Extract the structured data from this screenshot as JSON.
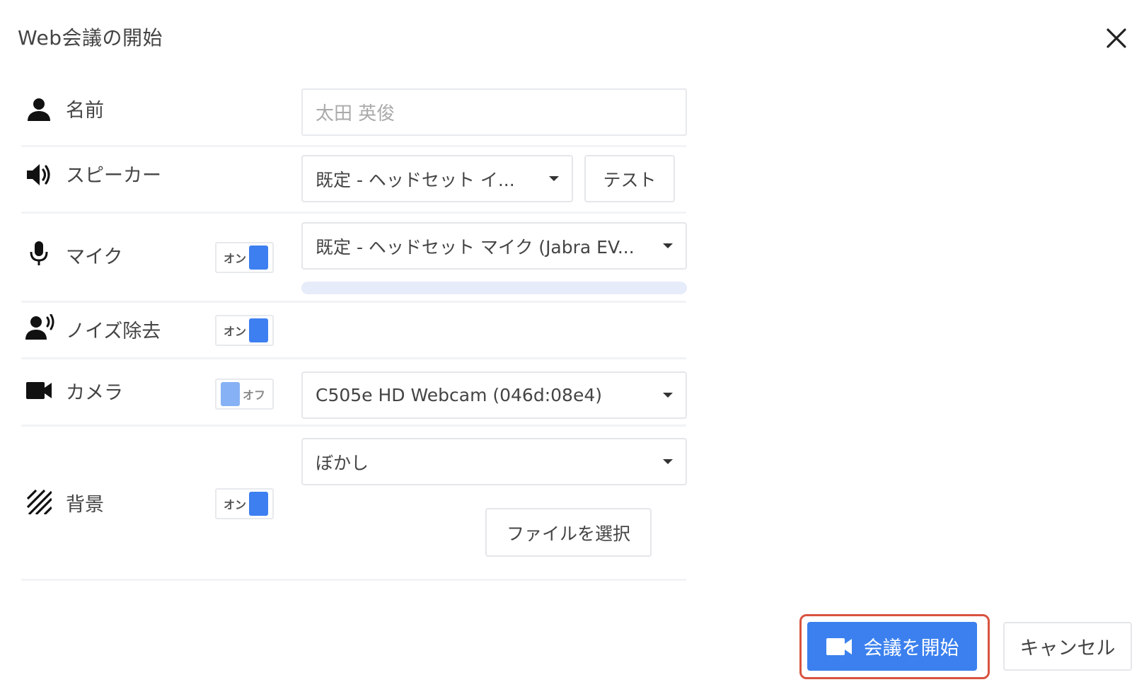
{
  "dialog": {
    "title": "Web会議の開始"
  },
  "name_row": {
    "label": "名前",
    "value": "太田 英俊"
  },
  "speaker_row": {
    "label": "スピーカー",
    "selected": "既定 - ヘッドセット イ...",
    "test_label": "テスト"
  },
  "mic_row": {
    "label": "マイク",
    "toggle_label": "オン",
    "toggle_state": "on",
    "selected": "既定 - ヘッドセット マイク (Jabra EV...",
    "input_level": 0
  },
  "noise_row": {
    "label": "ノイズ除去",
    "toggle_label": "オン",
    "toggle_state": "on"
  },
  "camera_row": {
    "label": "カメラ",
    "toggle_label": "オフ",
    "toggle_state": "off",
    "selected": "C505e HD Webcam (046d:08e4)"
  },
  "background_row": {
    "label": "背景",
    "toggle_label": "オン",
    "toggle_state": "on",
    "selected": "ぼかし",
    "file_button_label": "ファイルを選択"
  },
  "footer": {
    "start_label": "会議を開始",
    "cancel_label": "キャンセル"
  },
  "colors": {
    "accent": "#3b80ee",
    "highlight": "#d9533f",
    "toggle_off": "#86b1f4"
  },
  "icons": {
    "close": "close-icon",
    "name": "person-icon",
    "speaker": "speaker-icon",
    "mic": "microphone-icon",
    "noise": "voice-user-icon",
    "camera": "video-camera-icon",
    "background": "diagonal-lines-icon",
    "start": "video-camera-icon"
  }
}
